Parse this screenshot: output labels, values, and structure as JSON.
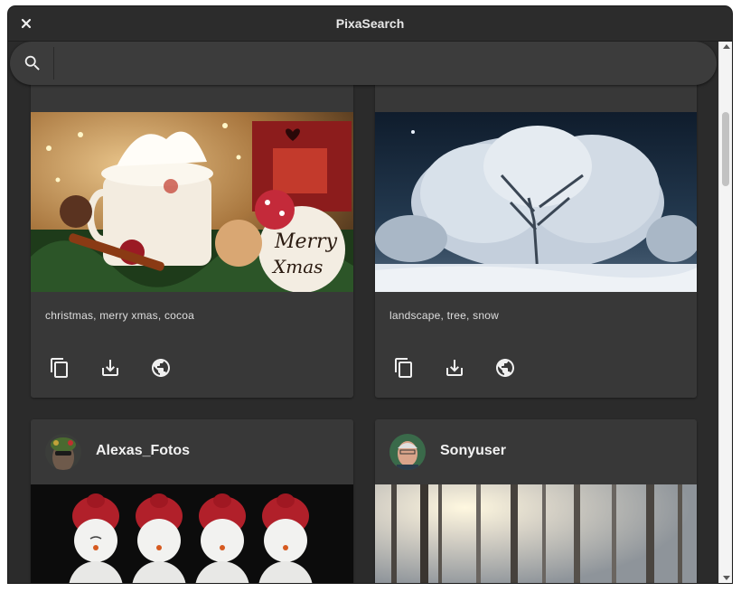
{
  "window": {
    "title": "PixaSearch"
  },
  "search": {
    "value": "",
    "placeholder": ""
  },
  "cards": [
    {
      "tags": "christmas, merry xmas, cocoa"
    },
    {
      "tags": "landscape, tree, snow"
    },
    {
      "username": "Alexas_Fotos"
    },
    {
      "username": "Sonyuser"
    }
  ],
  "icons": {
    "close": "close-icon",
    "search": "search-icon",
    "copy": "copy-icon",
    "download": "download-icon",
    "open": "globe-icon"
  },
  "colors": {
    "window_bg": "#2b2b2b",
    "card_bg": "#383838",
    "searchbar_bg": "#3c3c3c",
    "text": "#dedede",
    "avatar_green": "#7cc242"
  }
}
